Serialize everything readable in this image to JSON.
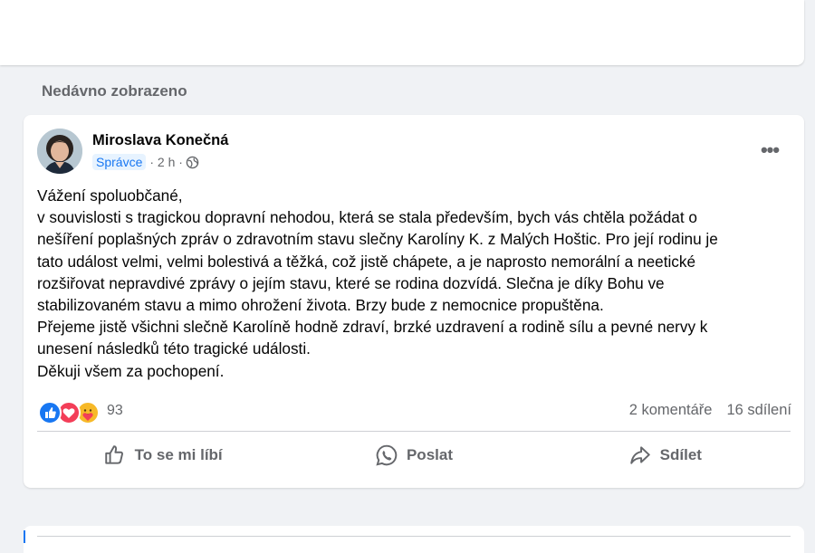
{
  "section": {
    "title": "Nedávno zobrazeno"
  },
  "post": {
    "author": "Miroslava Konečná",
    "role": "Správce",
    "time": "· 2 h ·",
    "more_label": "•••",
    "body": [
      "Vážení spoluobčané,",
      "v souvislosti s tragickou dopravní nehodou, která se stala především, bych vás chtěla požádat o",
      "nešíření poplašných zpráv o zdravotním stavu slečny Karolíny K. z Malých Hoštic. Pro její rodinu je",
      "tato událost velmi, velmi bolestivá a těžká, což jistě chápete, a je naprosto nemorální a neetické",
      "rozšiřovat nepravdivé zprávy o jejím stavu, které se rodina dozvídá. Slečna je díky Bohu ve",
      "stabilizovaném stavu a mimo ohrožení života. Brzy bude z nemocnice propuštěna.",
      "Přejeme jistě všichni slečně Karolíně hodně zdraví, brzké uzdravení a rodině sílu a pevné nervy k",
      "unesení následků této tragické události.",
      "Děkuji všem za pochopení."
    ],
    "reactions": {
      "icons": [
        "like-icon",
        "love-icon",
        "care-icon"
      ],
      "count": "93"
    },
    "comments": "2 komentáře",
    "shares": "16 sdílení",
    "actions": {
      "like": "To se mi líbí",
      "send": "Poslat",
      "share": "Sdílet"
    }
  },
  "colors": {
    "background": "#f0f2f5",
    "card": "#ffffff",
    "secondary_text": "#65676b",
    "accent": "#1877f2",
    "like": "#1877f2",
    "love": "#f33e58",
    "care": "#f7b928"
  }
}
